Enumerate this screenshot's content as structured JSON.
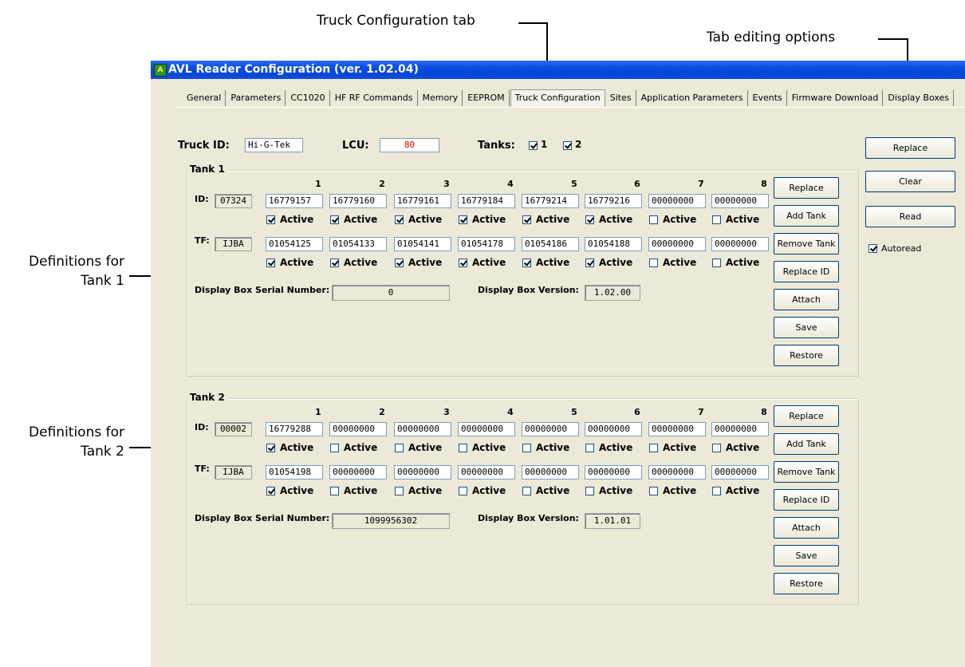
{
  "annotations": {
    "truck_tab": "Truck Configuration tab",
    "tab_edit": "Tab editing options",
    "tank1_def": "Definitions for\nTank 1",
    "tank2_def": "Definitions for\nTank 2"
  },
  "window": {
    "title": "AVL Reader Configuration (ver. 1.02.04)"
  },
  "tabs": [
    "General",
    "Parameters",
    "CC1020",
    "HF RF Commands",
    "Memory",
    "EEPROM",
    "Truck Configuration",
    "Sites",
    "Application Parameters",
    "Events",
    "Firmware Download",
    "Display Boxes"
  ],
  "active_tab": "Truck Configuration",
  "header": {
    "truck_id_label": "Truck ID:",
    "truck_id": "Hi-G-Tek",
    "lcu_label": "LCU:",
    "lcu": "80",
    "tanks_label": "Tanks:",
    "tank1_check": "1",
    "tank2_check": "2"
  },
  "side": {
    "replace": "Replace",
    "clear": "Clear",
    "read": "Read",
    "autoread": "Autoread"
  },
  "common": {
    "active": "Active",
    "id_label": "ID:",
    "tf_label": "TF:",
    "dbsn_label": "Display Box Serial Number:",
    "dbv_label": "Display Box Version:",
    "cols": [
      "1",
      "2",
      "3",
      "4",
      "5",
      "6",
      "7",
      "8"
    ],
    "btn_replace": "Replace",
    "btn_add": "Add Tank",
    "btn_remove": "Remove Tank",
    "btn_replace_id": "Replace ID",
    "btn_attach": "Attach",
    "btn_save": "Save",
    "btn_restore": "Restore"
  },
  "tanks": [
    {
      "title": "Tank 1",
      "id": "07324",
      "ids": [
        "16779157",
        "16779160",
        "16779161",
        "16779184",
        "16779214",
        "16779216",
        "00000000",
        "00000000"
      ],
      "id_active": [
        true,
        true,
        true,
        true,
        true,
        true,
        false,
        false
      ],
      "tf": "IJBA",
      "tfs": [
        "01054125",
        "01054133",
        "01054141",
        "01054178",
        "01054186",
        "01054188",
        "00000000",
        "00000000"
      ],
      "tf_active": [
        true,
        true,
        true,
        true,
        true,
        true,
        false,
        false
      ],
      "serial": "0",
      "version": "1.02.00"
    },
    {
      "title": "Tank 2",
      "id": "00002",
      "ids": [
        "16779288",
        "00000000",
        "00000000",
        "00000000",
        "00000000",
        "00000000",
        "00000000",
        "00000000"
      ],
      "id_active": [
        true,
        false,
        false,
        false,
        false,
        false,
        false,
        false
      ],
      "tf": "IJBA",
      "tfs": [
        "01054198",
        "00000000",
        "00000000",
        "00000000",
        "00000000",
        "00000000",
        "00000000",
        "00000000"
      ],
      "tf_active": [
        true,
        false,
        false,
        false,
        false,
        false,
        false,
        false
      ],
      "serial": "1099956302",
      "version": "1.01.01"
    }
  ]
}
